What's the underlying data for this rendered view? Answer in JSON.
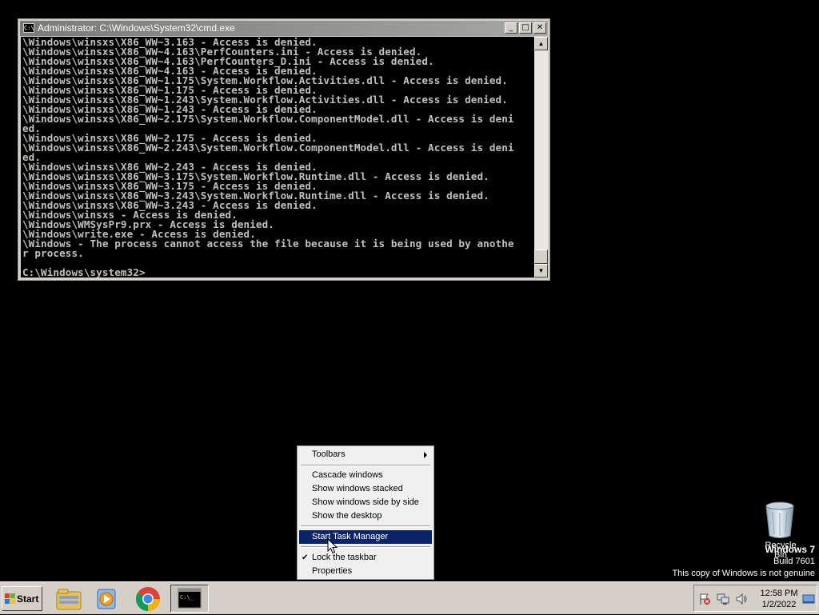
{
  "cmd": {
    "title": "Administrator: C:\\Windows\\System32\\cmd.exe",
    "icon_text": "C:\\",
    "lines": [
      "\\Windows\\winsxs\\X86_WW~3.163 - Access is denied.",
      "\\Windows\\winsxs\\X86_WW~4.163\\PerfCounters.ini - Access is denied.",
      "\\Windows\\winsxs\\X86_WW~4.163\\PerfCounters_D.ini - Access is denied.",
      "\\Windows\\winsxs\\X86_WW~4.163 - Access is denied.",
      "\\Windows\\winsxs\\X86_WW~1.175\\System.Workflow.Activities.dll - Access is denied.",
      "\\Windows\\winsxs\\X86_WW~1.175 - Access is denied.",
      "\\Windows\\winsxs\\X86_WW~1.243\\System.Workflow.Activities.dll - Access is denied.",
      "\\Windows\\winsxs\\X86_WW~1.243 - Access is denied.",
      "\\Windows\\winsxs\\X86_WW~2.175\\System.Workflow.ComponentModel.dll - Access is deni",
      "ed.",
      "\\Windows\\winsxs\\X86_WW~2.175 - Access is denied.",
      "\\Windows\\winsxs\\X86_WW~2.243\\System.Workflow.ComponentModel.dll - Access is deni",
      "ed.",
      "\\Windows\\winsxs\\X86_WW~2.243 - Access is denied.",
      "\\Windows\\winsxs\\X86_WW~3.175\\System.Workflow.Runtime.dll - Access is denied.",
      "\\Windows\\winsxs\\X86_WW~3.175 - Access is denied.",
      "\\Windows\\winsxs\\X86_WW~3.243\\System.Workflow.Runtime.dll - Access is denied.",
      "\\Windows\\winsxs\\X86_WW~3.243 - Access is denied.",
      "\\Windows\\winsxs - Access is denied.",
      "\\Windows\\WMSysPr9.prx - Access is denied.",
      "\\Windows\\write.exe - Access is denied.",
      "\\Windows - The process cannot access the file because it is being used by anothe",
      "r process.",
      "",
      "C:\\Windows\\system32>"
    ],
    "min_glyph": "_",
    "max_glyph": "□",
    "close_glyph": "✕"
  },
  "menu": {
    "toolbars": "Toolbars",
    "cascade": "Cascade windows",
    "stacked": "Show windows stacked",
    "side_by_side": "Show windows side by side",
    "show_desktop": "Show the desktop",
    "task_manager": "Start Task Manager",
    "lock": "Lock the taskbar",
    "properties": "Properties",
    "check_glyph": "✔"
  },
  "desktop": {
    "recycle_bin_label": "Recycle Bin",
    "watermark_title": "Windows 7",
    "watermark_build": "Build 7601",
    "watermark_notice": "This copy of Windows is not genuine"
  },
  "taskbar": {
    "start_label": "Start",
    "apps": [
      "file-explorer-icon",
      "media-player-icon",
      "chrome-icon",
      "cmd-icon"
    ],
    "clock_time": "12:58 PM",
    "clock_date": "1/2/2022"
  },
  "colors": {
    "menu_highlight": "#0a246a",
    "taskbar_bg": "#d4d0c8",
    "cmd_text": "#c0c0c0"
  }
}
